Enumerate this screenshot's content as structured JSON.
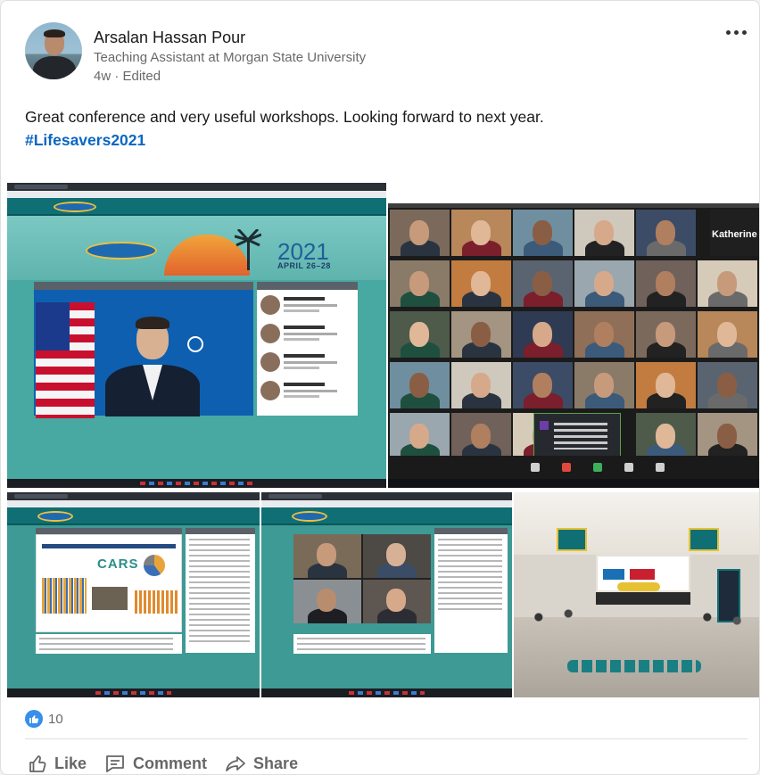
{
  "post": {
    "author": {
      "name": "Arsalan Hassan Pour",
      "headline": "Teaching Assistant at Morgan State University",
      "meta": "4w · Edited"
    },
    "text": "Great conference and very useful workshops. Looking forward to next year.",
    "hashtag": "#Lifesavers2021",
    "media": {
      "conference_year": "2021",
      "conference_dates": "APRIL 26–28",
      "zoom_name_label": "Katherine",
      "slide_logo": "CARS"
    },
    "reactions": {
      "count": "10"
    },
    "actions": {
      "like": "Like",
      "comment": "Comment",
      "share": "Share"
    }
  },
  "icons": {
    "more": "ellipsis-icon",
    "reaction": "thumbs-up-icon",
    "like": "thumbs-up-outline-icon",
    "comment": "comment-icon",
    "share": "share-arrow-icon"
  },
  "colors": {
    "link": "#0a66c2",
    "like_badge": "#378fe9",
    "teal": "#3e9a94"
  }
}
